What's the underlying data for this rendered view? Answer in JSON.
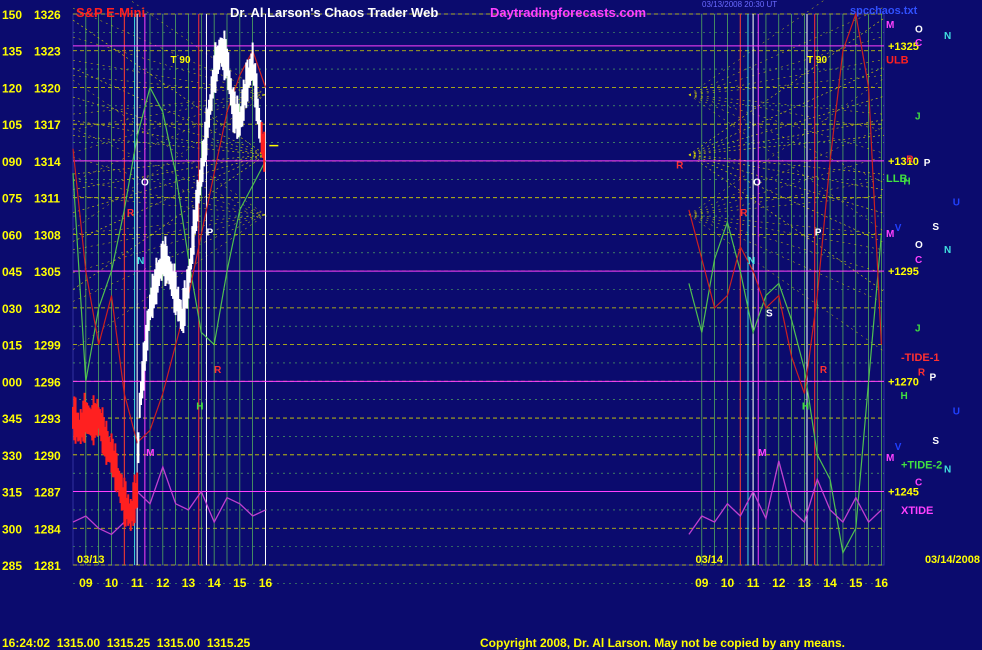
{
  "header": {
    "instrument": "S&P E-Mini",
    "site_title": "Dr. Al Larson's Chaos Trader Web",
    "site_url": "Daytradingforecasts.com",
    "timestamp": "03/13/2008 20:30 UT",
    "file": "spcchaos.txt"
  },
  "footer": {
    "quote": "16:24:02  1315.00  1315.25  1315.00  1315.25",
    "copyright": "Copyright 2008, Dr. Al Larson. May not be copied by any means."
  },
  "colors": {
    "background": "#0b0b6e",
    "grid_yellow": "#d8d800",
    "grid_green": "#5cc05c",
    "price_bars": "#ffffff",
    "price_bars_down": "#ff2020",
    "xtide": "#c040d0",
    "red_curve": "#cc2020",
    "green_curve": "#50c050",
    "header_red": "#ff2020",
    "header_magenta": "#ff40ff"
  },
  "chart_data": {
    "type": "line",
    "title": "S&P E-Mini",
    "ylim": [
      1281,
      1326
    ],
    "y_ticks": [
      {
        "angle": "150",
        "price": "1326",
        "value": 1326
      },
      {
        "angle": "135",
        "price": "1323",
        "value": 1323
      },
      {
        "angle": "120",
        "price": "1320",
        "value": 1320
      },
      {
        "angle": "105",
        "price": "1317",
        "value": 1317
      },
      {
        "angle": "090",
        "price": "1314",
        "value": 1314
      },
      {
        "angle": "075",
        "price": "1311",
        "value": 1311
      },
      {
        "angle": "060",
        "price": "1308",
        "value": 1308
      },
      {
        "angle": "045",
        "price": "1305",
        "value": 1305
      },
      {
        "angle": "030",
        "price": "1302",
        "value": 1302
      },
      {
        "angle": "015",
        "price": "1299",
        "value": 1299
      },
      {
        "angle": "000",
        "price": "1296",
        "value": 1296
      },
      {
        "angle": "345",
        "price": "1293",
        "value": 1293
      },
      {
        "angle": "330",
        "price": "1290",
        "value": 1290
      },
      {
        "angle": "315",
        "price": "1287",
        "value": 1287
      },
      {
        "angle": "300",
        "price": "1284",
        "value": 1284
      },
      {
        "angle": "285",
        "price": "1281",
        "value": 1281
      }
    ],
    "x_ticks": [
      {
        "label": "09",
        "hour": 9
      },
      {
        "label": "10",
        "hour": 10
      },
      {
        "label": "11",
        "hour": 11
      },
      {
        "label": "12",
        "hour": 12
      },
      {
        "label": "13",
        "hour": 13
      },
      {
        "label": "14",
        "hour": 14
      },
      {
        "label": "15",
        "hour": 15
      },
      {
        "label": "16",
        "hour": 16
      },
      {
        "label": "09",
        "hour": 33
      },
      {
        "label": "10",
        "hour": 34
      },
      {
        "label": "11",
        "hour": 35
      },
      {
        "label": "12",
        "hour": 36
      },
      {
        "label": "13",
        "hour": 37
      },
      {
        "label": "14",
        "hour": 38
      },
      {
        "label": "15",
        "hour": 39
      },
      {
        "label": "16",
        "hour": 40
      }
    ],
    "xlim": [
      8.5,
      40.1
    ],
    "date_labels": [
      {
        "text": "03/13",
        "hour": 8.5
      },
      {
        "text": "03/14",
        "hour": 32.6
      },
      {
        "text": "03/14/2008",
        "hour": 40.6
      }
    ],
    "price_series": {
      "name": "S&P E-Mini",
      "x": [
        8.5,
        8.75,
        9.0,
        9.25,
        9.5,
        9.75,
        10.0,
        10.25,
        10.5,
        10.75,
        11.0,
        11.1,
        11.25,
        11.5,
        11.75,
        12.0,
        12.25,
        12.5,
        12.75,
        13.0,
        13.25,
        13.5,
        13.75,
        14.0,
        14.25,
        14.5,
        14.75,
        15.0,
        15.25,
        15.5,
        15.75,
        16.0
      ],
      "y": [
        1293,
        1292,
        1293,
        1292.5,
        1293,
        1291,
        1290,
        1288,
        1286,
        1285,
        1287,
        1294,
        1297,
        1302,
        1304,
        1306,
        1305,
        1303,
        1301,
        1304,
        1309,
        1313,
        1317,
        1321,
        1323,
        1322,
        1318,
        1317,
        1320,
        1322,
        1317,
        1314
      ],
      "last": 1315.25
    },
    "gann_levels": [
      {
        "label": "1325",
        "value": 1323.4
      },
      {
        "label": "1310",
        "value": 1314.0
      },
      {
        "label": "1295",
        "value": 1305.0
      },
      {
        "label": "1270",
        "value": 1296.0
      },
      {
        "label": "1245",
        "value": 1287.0
      }
    ],
    "band_labels": [
      {
        "text": "ULB",
        "value": 1322.3,
        "color": "#ff2020"
      },
      {
        "text": "LLB",
        "value": 1312.6,
        "color": "#40e040"
      }
    ],
    "vertical_markers": [
      {
        "text": "T 90",
        "hour": 12.3,
        "value": 1322
      },
      {
        "text": "T 90",
        "hour": 37.1,
        "value": 1322
      }
    ],
    "planet_labels": [
      {
        "text": "O",
        "hour": 11.15,
        "value": 1312,
        "color": "#ffffff"
      },
      {
        "text": "R",
        "hour": 10.6,
        "value": 1309.5,
        "color": "#ff3030"
      },
      {
        "text": "N",
        "hour": 11.0,
        "value": 1305.6,
        "color": "#40e0e0"
      },
      {
        "text": "P",
        "hour": 13.7,
        "value": 1307.9,
        "color": "#ffffff"
      },
      {
        "text": "H",
        "hour": 13.3,
        "value": 1293.7,
        "color": "#40e040"
      },
      {
        "text": "R",
        "hour": 14.0,
        "value": 1296.7,
        "color": "#ff3030"
      },
      {
        "text": "M",
        "hour": 11.35,
        "value": 1289.9,
        "color": "#ff40ff"
      },
      {
        "text": "O",
        "hour": 35.0,
        "value": 1312,
        "color": "#ffffff"
      },
      {
        "text": "R",
        "hour": 34.5,
        "value": 1309.5,
        "color": "#ff3030"
      },
      {
        "text": "N",
        "hour": 34.8,
        "value": 1305.6,
        "color": "#40e0e0"
      },
      {
        "text": "P",
        "hour": 37.4,
        "value": 1307.9,
        "color": "#ffffff"
      },
      {
        "text": "H",
        "hour": 36.9,
        "value": 1293.7,
        "color": "#40e040"
      },
      {
        "text": "R",
        "hour": 37.6,
        "value": 1296.7,
        "color": "#ff3030"
      },
      {
        "text": "M",
        "hour": 35.2,
        "value": 1289.9,
        "color": "#ff40ff"
      },
      {
        "text": "S",
        "hour": 35.5,
        "value": 1301.3,
        "color": "#ffffff"
      },
      {
        "text": "R",
        "hour": 32.0,
        "value": 1313.4,
        "color": "#ff3030"
      }
    ],
    "right_labels": [
      {
        "text": "M",
        "value": 1325.2,
        "col": 0,
        "color": "#ff40ff"
      },
      {
        "text": "O",
        "value": 1324.8,
        "col": 1,
        "color": "#ffffff"
      },
      {
        "text": "N",
        "value": 1324.3,
        "col": 2,
        "color": "#40e0e0"
      },
      {
        "text": "C",
        "value": 1323.7,
        "col": 1,
        "color": "#ff40ff"
      },
      {
        "text": "J",
        "value": 1317.7,
        "col": 1,
        "color": "#40e040"
      },
      {
        "text": "R",
        "value": 1314.2,
        "col": 0.7,
        "color": "#ff3030"
      },
      {
        "text": "P",
        "value": 1313.9,
        "col": 1.3,
        "color": "#ffffff"
      },
      {
        "text": "H",
        "value": 1312.4,
        "col": 0.6,
        "color": "#40e040"
      },
      {
        "text": "U",
        "value": 1310.7,
        "col": 2.3,
        "color": "#2040ff"
      },
      {
        "text": "S",
        "value": 1308.7,
        "col": 1.6,
        "color": "#ffffff"
      },
      {
        "text": "V",
        "value": 1308.6,
        "col": 0.3,
        "color": "#2040ff"
      },
      {
        "text": "M",
        "value": 1308.1,
        "col": 0,
        "color": "#ff40ff"
      },
      {
        "text": "O",
        "value": 1307.2,
        "col": 1,
        "color": "#ffffff"
      },
      {
        "text": "N",
        "value": 1306.8,
        "col": 2,
        "color": "#40e0e0"
      },
      {
        "text": "C",
        "value": 1306.0,
        "col": 1,
        "color": "#ff40ff"
      },
      {
        "text": "J",
        "value": 1300.4,
        "col": 1,
        "color": "#40e040"
      },
      {
        "text": "R",
        "value": 1296.8,
        "col": 1.1,
        "color": "#ff3030"
      },
      {
        "text": "P",
        "value": 1296.4,
        "col": 1.5,
        "color": "#ffffff"
      },
      {
        "text": "H",
        "value": 1294.9,
        "col": 0.5,
        "color": "#40e040"
      },
      {
        "text": "U",
        "value": 1293.6,
        "col": 2.3,
        "color": "#2040ff"
      },
      {
        "text": "S",
        "value": 1291.2,
        "col": 1.6,
        "color": "#ffffff"
      },
      {
        "text": "V",
        "value": 1290.7,
        "col": 0.3,
        "color": "#2040ff"
      },
      {
        "text": "M",
        "value": 1289.8,
        "col": 0,
        "color": "#ff40ff"
      },
      {
        "text": "N",
        "value": 1288.9,
        "col": 2.0,
        "color": "#40e0e0"
      },
      {
        "text": "C",
        "value": 1287.8,
        "col": 1,
        "color": "#ff40ff"
      }
    ],
    "tide_labels": [
      {
        "text": "-TIDE-1",
        "value": 1298.0,
        "color": "#ff3030"
      },
      {
        "text": "+TIDE-2",
        "value": 1289.2,
        "color": "#40e040"
      },
      {
        "text": "XTIDE",
        "value": 1285.5,
        "color": "#ff40ff"
      }
    ],
    "xtide_series": {
      "name": "XTIDE",
      "x": [
        8.5,
        9.0,
        9.5,
        10.0,
        10.5,
        11.0,
        11.5,
        12.0,
        12.5,
        13.0,
        13.5,
        14.0,
        14.5,
        15.0,
        15.5,
        16.0,
        32.5,
        33.0,
        33.5,
        34.0,
        34.5,
        35.0,
        35.5,
        36.0,
        36.5,
        37.0,
        37.5,
        38.0,
        38.5,
        39.0,
        39.5,
        40.0
      ],
      "y": [
        1284.5,
        1285,
        1284,
        1283.5,
        1284.5,
        1287,
        1286,
        1289,
        1286,
        1285.5,
        1287,
        1284.5,
        1286.5,
        1286,
        1285,
        1285.5,
        1283.5,
        1285,
        1284.5,
        1286,
        1285,
        1287,
        1284.8,
        1289.5,
        1285.5,
        1284.5,
        1288,
        1285.5,
        1284.5,
        1286.5,
        1284.5,
        1285.5
      ]
    },
    "red_series": {
      "name": "-TIDE-1",
      "x": [
        8.5,
        9.0,
        9.5,
        10.0,
        10.5,
        11.0,
        11.5,
        12.0,
        12.5,
        13.0,
        13.5,
        14.0,
        14.5,
        15.0,
        15.5,
        16.0,
        32.5,
        33.0,
        33.5,
        34.0,
        34.5,
        35.0,
        35.5,
        36.0,
        36.5,
        37.0,
        37.5,
        38.0,
        38.5,
        39.0,
        39.5,
        40.0
      ],
      "y": [
        1315,
        1305,
        1299,
        1303,
        1295,
        1291,
        1292,
        1295,
        1299,
        1303,
        1308,
        1313,
        1318,
        1321,
        1323,
        1320,
        1310,
        1306,
        1302,
        1303,
        1307,
        1305,
        1302,
        1303,
        1298,
        1295,
        1303,
        1314,
        1323,
        1326,
        1320,
        1299
      ]
    },
    "green_series": {
      "name": "+TIDE-2",
      "x": [
        8.5,
        9.0,
        9.5,
        10.0,
        10.5,
        11.0,
        11.5,
        12.0,
        12.5,
        13.0,
        13.5,
        14.0,
        14.5,
        15.0,
        15.5,
        16.0,
        32.5,
        33.0,
        33.5,
        34.0,
        34.5,
        35.0,
        35.5,
        36.0,
        36.5,
        37.0,
        37.5,
        38.0,
        38.5,
        39.0,
        39.5,
        40.0
      ],
      "y": [
        1313,
        1296,
        1302,
        1305,
        1310,
        1316,
        1320,
        1318,
        1313,
        1306,
        1300,
        1299,
        1305,
        1310,
        1312,
        1314,
        1304,
        1300,
        1306,
        1309,
        1305,
        1300,
        1303,
        1304,
        1301,
        1297,
        1290,
        1288,
        1282,
        1284,
        1296,
        1308
      ]
    },
    "fan_centers": [
      {
        "hour": 16.0,
        "value": 1314.5
      },
      {
        "hour": 32.5,
        "value": 1314.5
      }
    ]
  }
}
